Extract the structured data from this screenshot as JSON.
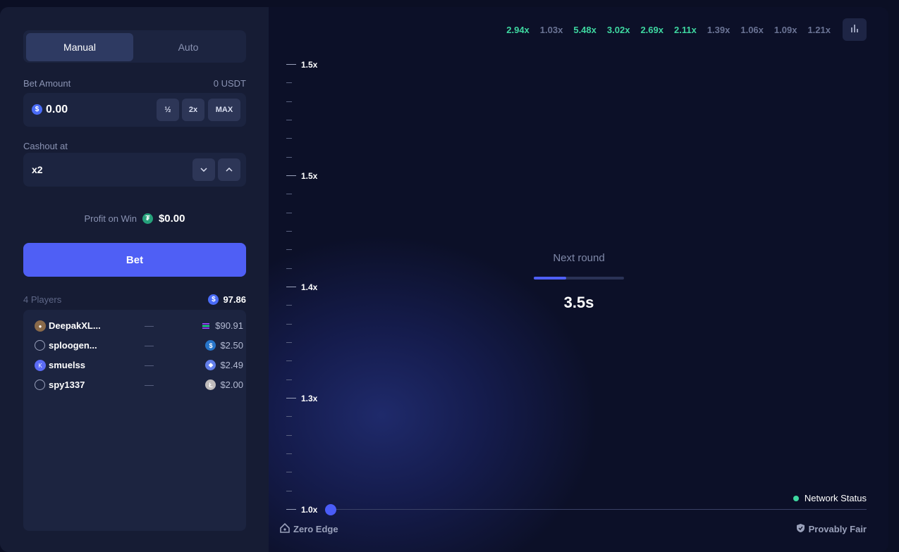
{
  "tabs": {
    "manual": "Manual",
    "auto": "Auto"
  },
  "bet": {
    "label": "Bet Amount",
    "balance": "0 USDT",
    "value": "0.00",
    "half": "½",
    "double": "2x",
    "max": "MAX"
  },
  "cashout": {
    "label": "Cashout at",
    "value": "x2"
  },
  "profit": {
    "label": "Profit on Win",
    "value": "$0.00"
  },
  "bet_button": "Bet",
  "players": {
    "count_label": "4 Players",
    "total": "97.86",
    "rows": [
      {
        "name": "DeepakXL...",
        "dash": "—",
        "amount": "$90.91",
        "currency_icon": "solana-icon"
      },
      {
        "name": "sploogen...",
        "dash": "—",
        "amount": "$2.50",
        "currency_icon": "usdc-icon"
      },
      {
        "name": "smuelss",
        "dash": "—",
        "amount": "$2.49",
        "currency_icon": "ethereum-icon"
      },
      {
        "name": "spy1337",
        "dash": "—",
        "amount": "$2.00",
        "currency_icon": "litecoin-icon"
      }
    ]
  },
  "history": [
    {
      "value": "2.94x",
      "color": "#3ed7a0"
    },
    {
      "value": "1.03x",
      "color": "#6a7394"
    },
    {
      "value": "5.48x",
      "color": "#3ed7a0"
    },
    {
      "value": "3.02x",
      "color": "#3ed7a0"
    },
    {
      "value": "2.69x",
      "color": "#3ed7a0"
    },
    {
      "value": "2.11x",
      "color": "#3ed7a0"
    },
    {
      "value": "1.39x",
      "color": "#6a7394"
    },
    {
      "value": "1.06x",
      "color": "#6a7394"
    },
    {
      "value": "1.09x",
      "color": "#6a7394"
    },
    {
      "value": "1.21x",
      "color": "#6a7394"
    }
  ],
  "y_axis": [
    "1.5x",
    "1.5x",
    "1.4x",
    "1.3x",
    "1.0x"
  ],
  "next_round": {
    "label": "Next round",
    "countdown": "3.5s",
    "progress": 0.36
  },
  "network_status": "Network Status",
  "footer": {
    "zero_edge": "Zero Edge",
    "provably_fair": "Provably Fair"
  },
  "colors": {
    "accent": "#4f5ff5",
    "win": "#3ed7a0",
    "loss": "#6a7394"
  }
}
